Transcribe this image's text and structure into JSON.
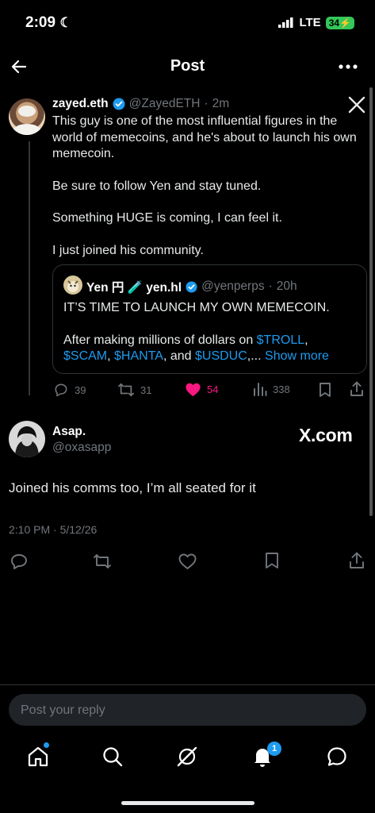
{
  "status_bar": {
    "time": "2:09",
    "network": "LTE",
    "battery": "34"
  },
  "header": {
    "title": "Post"
  },
  "main_post": {
    "display_name": "zayed.eth",
    "handle": "@ZayedETH",
    "time": "2m",
    "paragraphs": [
      "This guy is one of the most influential figures in the world of memecoins, and he's about to launch his own memecoin.",
      "Be sure to follow Yen and stay tuned.",
      "Something HUGE is coming, I can feel it.",
      "I just joined his community."
    ],
    "quote": {
      "display_name": "Yen 円 🧪 yen.hl",
      "handle": "@yenperps",
      "time": "20h",
      "line1": "IT’S TIME TO LAUNCH MY OWN MEMECOIN.",
      "line2_prefix": "After making millions of dollars on ",
      "tags": [
        "$TROLL",
        "$SCAM",
        "$HANTA",
        "$USDUC"
      ],
      "show_more": "Show more"
    },
    "actions": {
      "replies": "39",
      "reposts": "31",
      "likes": "54",
      "views": "338"
    }
  },
  "reply": {
    "display_name": "Asap.",
    "handle": "@oxasapp",
    "watermark": "X.com",
    "text": "Joined his comms too, I’m all seated for it",
    "timestamp": "2:10 PM · 5/12/26"
  },
  "composer": {
    "placeholder": "Post your reply"
  },
  "bottom_nav": {
    "notifications_badge": "1"
  },
  "colors": {
    "accent": "#1d9bf0",
    "like": "#f91880",
    "background": "#000000",
    "text": "#e7e9ea",
    "muted": "#71767b"
  }
}
